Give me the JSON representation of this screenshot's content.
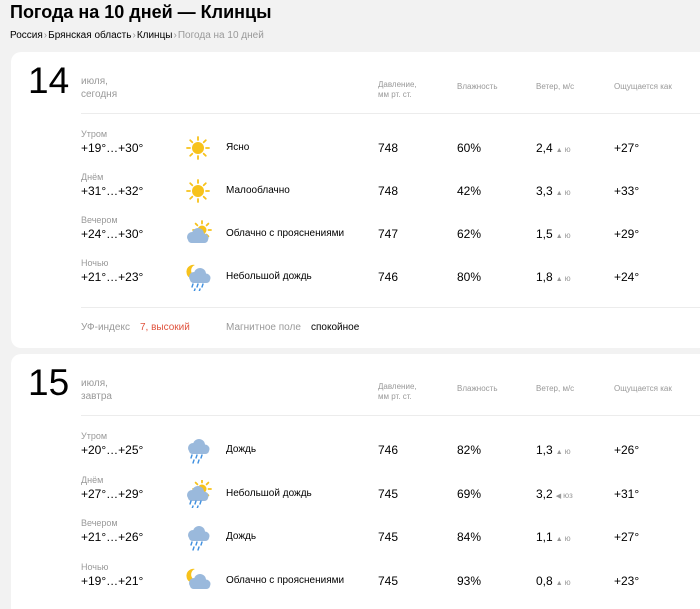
{
  "page": {
    "title": "Погода на 10 дней — Клинцы"
  },
  "breadcrumb": {
    "items": [
      "Россия",
      "Брянская область",
      "Клинцы"
    ],
    "current": "Погода на 10 дней"
  },
  "columns": {
    "pressure": [
      "Давление,",
      "мм рт. ст."
    ],
    "humidity": "Влажность",
    "wind": "Ветер, м/с",
    "feels": "Ощущается как"
  },
  "days": [
    {
      "day": "14",
      "month": "июля,",
      "weekday": "сегодня",
      "rows": [
        {
          "tod": "Утром",
          "temp": "+19°…+30°",
          "icon": "sun-icon",
          "cond": "Ясно",
          "press": "748",
          "hum": "60%",
          "wind": "2,4",
          "arrow": "▲",
          "dir": "ю",
          "feels": "+27°"
        },
        {
          "tod": "Днём",
          "temp": "+31°…+32°",
          "icon": "sun-icon",
          "cond": "Малооблачно",
          "press": "748",
          "hum": "42%",
          "wind": "3,3",
          "arrow": "▲",
          "dir": "ю",
          "feels": "+33°"
        },
        {
          "tod": "Вечером",
          "temp": "+24°…+30°",
          "icon": "partly-cloudy-icon",
          "cond": "Облачно с прояснениями",
          "press": "747",
          "hum": "62%",
          "wind": "1,5",
          "arrow": "▲",
          "dir": "ю",
          "feels": "+29°"
        },
        {
          "tod": "Ночью",
          "temp": "+21°…+23°",
          "icon": "night-rain-icon",
          "cond": "Небольшой дождь",
          "press": "746",
          "hum": "80%",
          "wind": "1,8",
          "arrow": "▲",
          "dir": "ю",
          "feels": "+24°"
        }
      ],
      "uv_label": "УФ-индекс",
      "uv_value": "7, высокий",
      "mag_label": "Магнитное поле",
      "mag_value": "спокойное"
    },
    {
      "day": "15",
      "month": "июля,",
      "weekday": "завтра",
      "rows": [
        {
          "tod": "Утром",
          "temp": "+20°…+25°",
          "icon": "rain-icon",
          "cond": "Дождь",
          "press": "746",
          "hum": "82%",
          "wind": "1,3",
          "arrow": "▲",
          "dir": "ю",
          "feels": "+26°"
        },
        {
          "tod": "Днём",
          "temp": "+27°…+29°",
          "icon": "sun-rain-icon",
          "cond": "Небольшой дождь",
          "press": "745",
          "hum": "69%",
          "wind": "3,2",
          "arrow": "◀",
          "dir": "юз",
          "feels": "+31°"
        },
        {
          "tod": "Вечером",
          "temp": "+21°…+26°",
          "icon": "rain-icon",
          "cond": "Дождь",
          "press": "745",
          "hum": "84%",
          "wind": "1,1",
          "arrow": "▲",
          "dir": "ю",
          "feels": "+27°"
        },
        {
          "tod": "Ночью",
          "temp": "+19°…+21°",
          "icon": "night-cloudy-icon",
          "cond": "Облачно с прояснениями",
          "press": "745",
          "hum": "93%",
          "wind": "0,8",
          "arrow": "▲",
          "dir": "ю",
          "feels": "+23°"
        }
      ]
    }
  ]
}
